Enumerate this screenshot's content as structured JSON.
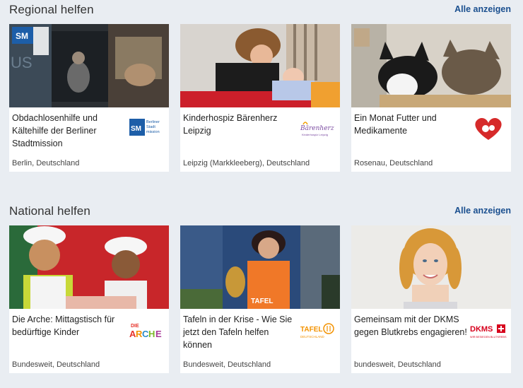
{
  "regional": {
    "title": "Regional helfen",
    "all_link": "Alle anzeigen",
    "cards": [
      {
        "title": "Obdachlosenhilfe und Kältehilfe der Berliner Stadtmission",
        "location": "Berlin, Deutschland",
        "logo_text": "SM",
        "logo_sub": "Berliner Stadt mission",
        "logo_color": "#1d5ea8"
      },
      {
        "title": "Kinderhospiz Bärenherz Leipzig",
        "location": "Leipzig (Markkleeberg), Deutschland",
        "logo_text": "Bärenherz",
        "logo_color": "#7a4aa0"
      },
      {
        "title": "Ein Monat Futter und Medikamente",
        "location": "Rosenau, Deutschland",
        "logo_color": "#d62a2a"
      }
    ]
  },
  "national": {
    "title": "National helfen",
    "all_link": "Alle anzeigen",
    "cards": [
      {
        "title": "Die Arche: Mittagstisch für bedürftige Kinder",
        "location": "Bundesweit, Deutschland",
        "logo_text": "DIE ARCHE",
        "logo_color": "#e6332a"
      },
      {
        "title": "Tafeln in der Krise - Wie Sie jetzt den Tafeln helfen können",
        "location": "Bundesweit, Deutschland",
        "logo_text": "TAFEL",
        "logo_sub": "DEUTSCHLAND",
        "logo_color": "#f39200"
      },
      {
        "title": "Gemeinsam mit der DKMS gegen Blutkrebs engagieren!",
        "location": "bundesweit, Deutschland",
        "logo_text": "DKMS",
        "logo_color": "#d7001d"
      }
    ]
  }
}
